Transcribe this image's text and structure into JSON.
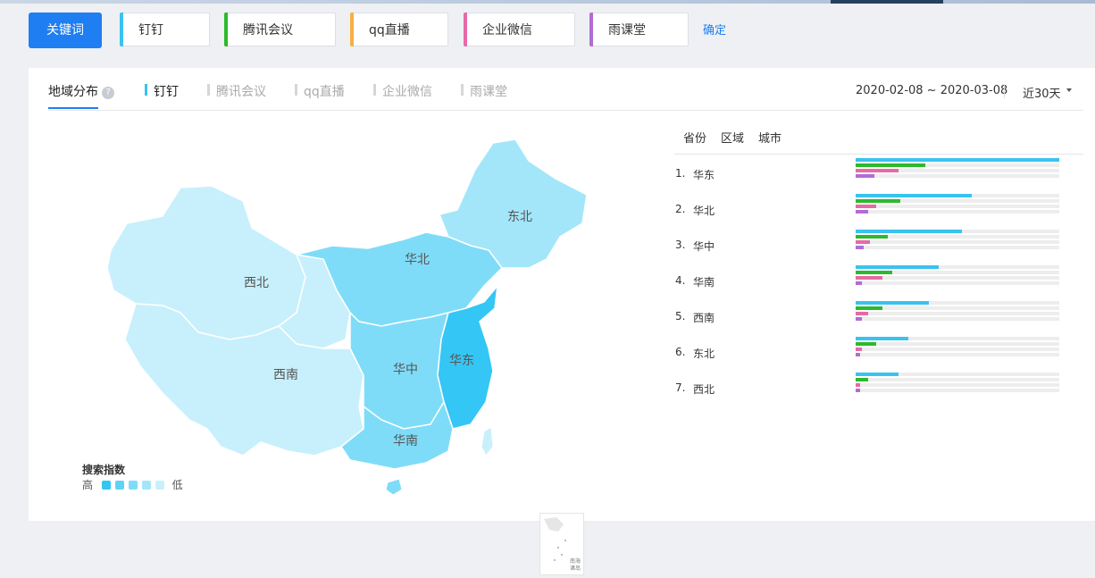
{
  "colors": {
    "accent": "#1f7ef1",
    "dingding": "#39c3ef",
    "tencent_meeting": "#2db92d",
    "qq_live": "#f7b043",
    "wework": "#e66aa5",
    "rain_classroom": "#b26cd2",
    "map_levels": [
      "#34c6f4",
      "#5fd2f6",
      "#7fdcf8",
      "#a3e6fa",
      "#c8f0fc"
    ]
  },
  "keyword_bar": {
    "keyword_button": "关键词",
    "chips": [
      {
        "label": "钉钉",
        "color": "#39c3ef"
      },
      {
        "label": "腾讯会议",
        "color": "#2db92d"
      },
      {
        "label": "qq直播",
        "color": "#f7b043"
      },
      {
        "label": "企业微信",
        "color": "#e66aa5"
      },
      {
        "label": "雨课堂",
        "color": "#b26cd2"
      }
    ],
    "confirm": "确定"
  },
  "panel": {
    "tab_title": "地域分布",
    "help_icon": "?",
    "series_tabs": [
      "钉钉",
      "腾讯会议",
      "qq直播",
      "企业微信",
      "雨课堂"
    ],
    "active_series": "钉钉",
    "date_range": "2020-02-08 ~ 2020-03-08",
    "period": "近30天"
  },
  "map": {
    "region_labels": [
      "东北",
      "华北",
      "西北",
      "西南",
      "华中",
      "华东",
      "华南"
    ],
    "legend_title": "搜索指数",
    "legend_high": "高",
    "legend_low": "低",
    "inset_label": "南海诸岛"
  },
  "ranking": {
    "subtabs": [
      "省份",
      "区域",
      "城市"
    ],
    "rows": [
      {
        "rank": "1.",
        "name": "华东",
        "values": {
          "dingding": 100,
          "tencent_meeting": 34,
          "wework": 21,
          "rain_classroom": 9
        }
      },
      {
        "rank": "2.",
        "name": "华北",
        "values": {
          "dingding": 57,
          "tencent_meeting": 22,
          "wework": 10,
          "rain_classroom": 6
        }
      },
      {
        "rank": "3.",
        "name": "华中",
        "values": {
          "dingding": 52,
          "tencent_meeting": 16,
          "wework": 7,
          "rain_classroom": 4
        }
      },
      {
        "rank": "4.",
        "name": "华南",
        "values": {
          "dingding": 41,
          "tencent_meeting": 18,
          "wework": 13,
          "rain_classroom": 3
        }
      },
      {
        "rank": "5.",
        "name": "西南",
        "values": {
          "dingding": 36,
          "tencent_meeting": 13,
          "wework": 6,
          "rain_classroom": 3
        }
      },
      {
        "rank": "6.",
        "name": "东北",
        "values": {
          "dingding": 26,
          "tencent_meeting": 10,
          "wework": 3,
          "rain_classroom": 2
        }
      },
      {
        "rank": "7.",
        "name": "西北",
        "values": {
          "dingding": 21,
          "tencent_meeting": 6,
          "wework": 2,
          "rain_classroom": 2
        }
      }
    ]
  }
}
